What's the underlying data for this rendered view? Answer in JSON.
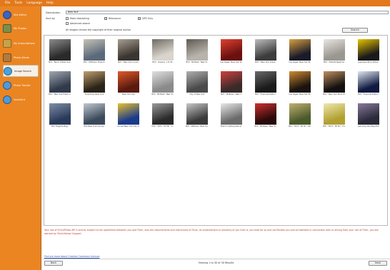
{
  "menu": [
    "File",
    "Tools",
    "Language",
    "Help"
  ],
  "sidebar": [
    {
      "label": "Site Editor",
      "color": "#3b64c2",
      "active": false
    },
    {
      "label": "My Photos",
      "color": "#7a8f4d",
      "active": false
    },
    {
      "label": "My Subscriptions",
      "color": "#c8a14a",
      "active": false
    },
    {
      "label": "Photo Album",
      "color": "#b07b3e",
      "active": false
    },
    {
      "label": "Image Search",
      "color": "#4aa3d8",
      "active": true
    },
    {
      "label": "Photo Tracker",
      "color": "#4f9ad6",
      "active": false
    },
    {
      "label": "Assistant",
      "color": "#4f9ad6",
      "active": false
    }
  ],
  "search": {
    "description_label": "Description",
    "description_value": "New York",
    "sort_label": "Sort by",
    "options": [
      {
        "label": "Most interesting",
        "checked": false
      },
      {
        "label": "Relevance",
        "checked": true
      },
      {
        "label": "GPS Only",
        "checked": true
      }
    ],
    "advanced_label": "Advanced search",
    "advanced_checked": false,
    "notice": "All images remain the copyright of their original author",
    "search_button": "Search"
  },
  "results": [
    {
      "caption": "NYC - Back of New York..",
      "colors": [
        "#2a2a2a",
        "#8c8c8c"
      ]
    },
    {
      "caption": "NYC - Midtown: Bryant..",
      "colors": [
        "#5b6a7a",
        "#c7c2b6"
      ]
    },
    {
      "caption": "NYC - New York Count..",
      "colors": [
        "#3a3530",
        "#a89f92"
      ]
    },
    {
      "caption": "NYC - Queens : LIC St..",
      "colors": [
        "#d9d4cc",
        "#6f6a62"
      ]
    },
    {
      "caption": "NYC - Midtown: New Yo..",
      "colors": [
        "#b8b3ab",
        "#5e5a52"
      ]
    },
    {
      "caption": "Las Vegas: New York N..",
      "colors": [
        "#6a1010",
        "#e04030"
      ]
    },
    {
      "caption": "NYC - New York Supre..",
      "colors": [
        "#3c3c3c",
        "#bdbdbd"
      ]
    },
    {
      "caption": "Las Vegas: New York N..",
      "colors": [
        "#1a1a2a",
        "#d8a040"
      ]
    },
    {
      "caption": "NYC - Federal Reserve..",
      "colors": [
        "#9a9690",
        "#e8e6e2"
      ]
    },
    {
      "caption": "Japanese Wine Yellow..",
      "colors": [
        "#1a1a1a",
        "#e8c400"
      ]
    },
    {
      "caption": "NYC - New York Public L..",
      "colors": [
        "#303a4a",
        "#a0a8b0"
      ]
    },
    {
      "caption": "Downtown New York",
      "colors": [
        "#2a2418",
        "#c0a070"
      ]
    },
    {
      "caption": "New York City",
      "colors": [
        "#5a1a10",
        "#e05a2a"
      ]
    },
    {
      "caption": "NYC - Midtown: New Yo..",
      "colors": [
        "#8a8a8a",
        "#e0e0e0"
      ]
    },
    {
      "caption": "City of New York",
      "colors": [
        "#4a4a4a",
        "#b0b0b0"
      ]
    },
    {
      "caption": "NYC - Midtown: New Y..",
      "colors": [
        "#3a2a2a",
        "#d04040"
      ]
    },
    {
      "caption": "NYC - Financial Distric..",
      "colors": [
        "#1a1a1a",
        "#6a6a6a"
      ]
    },
    {
      "caption": "Las Vegas: New York N..",
      "colors": [
        "#1a1410",
        "#d08a30"
      ]
    },
    {
      "caption": "NYC - New York Stock E..",
      "colors": [
        "#141010",
        "#c09060"
      ]
    },
    {
      "caption": "NYC - Financial Distric..",
      "colors": [
        "#101a40",
        "#e0e8f0"
      ]
    },
    {
      "caption": "NYC Flagship Bag..",
      "colors": [
        "#2a3a5a",
        "#8090a8"
      ]
    },
    {
      "caption": "NYC New York County..",
      "colors": [
        "#3a4a5a",
        "#c0c8d0"
      ]
    },
    {
      "caption": "La last New York City S..",
      "colors": [
        "#1a3a8a",
        "#e8c030"
      ]
    },
    {
      "caption": "NYC - 3071 - NY NY - C..",
      "colors": [
        "#2a2a2a",
        "#9a9a9a"
      ]
    },
    {
      "caption": "NYC - Midtown: New Yor..",
      "colors": [
        "#3a3a3a",
        "#c8c8c8"
      ]
    },
    {
      "caption": "Brand crashing dance..",
      "colors": [
        "#6a6a6a",
        "#e8e8e8"
      ]
    },
    {
      "caption": "NYC - Midtown: New Yo..",
      "colors": [
        "#2a0a0a",
        "#d03030"
      ]
    },
    {
      "caption": "NYC - 3071 - NY NY - Pa..",
      "colors": [
        "#4a5a2a",
        "#c0b070"
      ]
    },
    {
      "caption": "NYC - 3071 - NY NY - Fu..",
      "colors": [
        "#b0a030",
        "#f0e8b0"
      ]
    },
    {
      "caption": "Jamaring City Bag NYC",
      "colors": [
        "#2a2a3a",
        "#8a7a9a"
      ]
    }
  ],
  "legal_text": "Your use of Flickr/Photo API is strictly subject to the agreement between you and Flickr, also the requirements and restrictions of Flickr, as endorsement or warranty of you from it, you shall be up and set flexible you and all liabilities in connection with or arising from your use of Flickr, you are warned by Flickr/Yahoo! Support.",
  "cc_link": "Find out more about Creative Commons licenses",
  "footer": {
    "back_button": "Back",
    "status": "Viewing 1 to 30 of 30 Results",
    "next_button": "Next"
  }
}
